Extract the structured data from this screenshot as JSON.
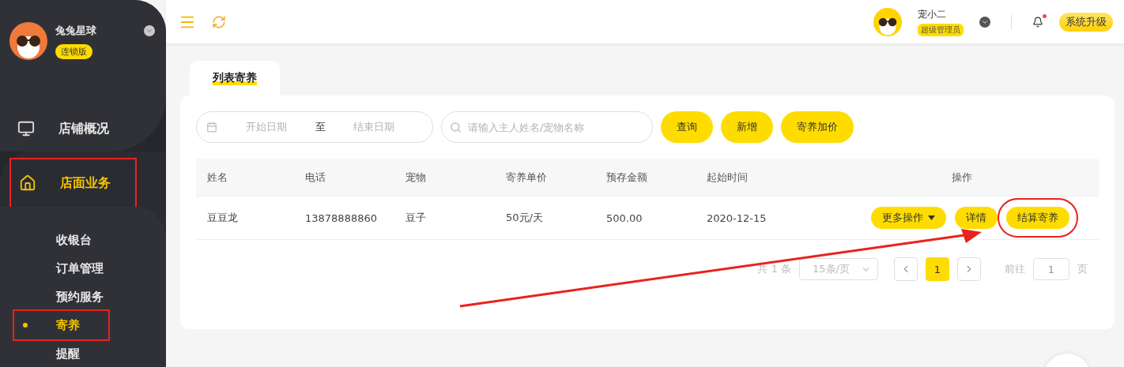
{
  "sidebar": {
    "store_name": "兔兔星球",
    "edition_badge": "连锁版",
    "menu": [
      {
        "label": "店铺概况",
        "kind": "monitor",
        "selected": false,
        "annotated": false
      },
      {
        "label": "店面业务",
        "kind": "home",
        "selected": true,
        "annotated": true,
        "children": [
          {
            "label": "收银台",
            "selected": false,
            "annotated": false
          },
          {
            "label": "订单管理",
            "selected": false,
            "annotated": false
          },
          {
            "label": "预约服务",
            "selected": false,
            "annotated": false
          },
          {
            "label": "寄养",
            "selected": true,
            "annotated": true
          },
          {
            "label": "提醒",
            "selected": false,
            "annotated": false
          }
        ]
      }
    ]
  },
  "header": {
    "user_name": "宠小二",
    "role_badge": "超级管理员",
    "unread": true,
    "upgrade_button": "系统升级"
  },
  "tabs": [
    {
      "label": "列表寄养",
      "selected": true
    }
  ],
  "filters": {
    "date_start_placeholder": "开始日期",
    "date_separator": "至",
    "date_end_placeholder": "结束日期",
    "search_placeholder": "请输入主人姓名/宠物名称",
    "buttons": [
      "查询",
      "新增",
      "寄养加价"
    ]
  },
  "table": {
    "columns": [
      "姓名",
      "电话",
      "宠物",
      "寄养单价",
      "预存金额",
      "起始时间",
      "操作"
    ],
    "rows": [
      {
        "cells": [
          "豆豆龙",
          "13878888860",
          "豆子",
          "50元/天",
          "500.00",
          "2020-12-15"
        ],
        "actions": [
          {
            "label": "更多操作",
            "kind": "dropdown",
            "annotated": false
          },
          {
            "label": "详情",
            "kind": "plain",
            "annotated": false
          },
          {
            "label": "结算寄养",
            "kind": "plain",
            "annotated": true
          }
        ]
      }
    ]
  },
  "pagination": {
    "total": "共 1 条",
    "page_size": "15条/页",
    "pages": [
      {
        "label": "1",
        "selected": true
      }
    ],
    "goto_label": "前往",
    "goto_value": "1",
    "goto_suffix": "页"
  }
}
